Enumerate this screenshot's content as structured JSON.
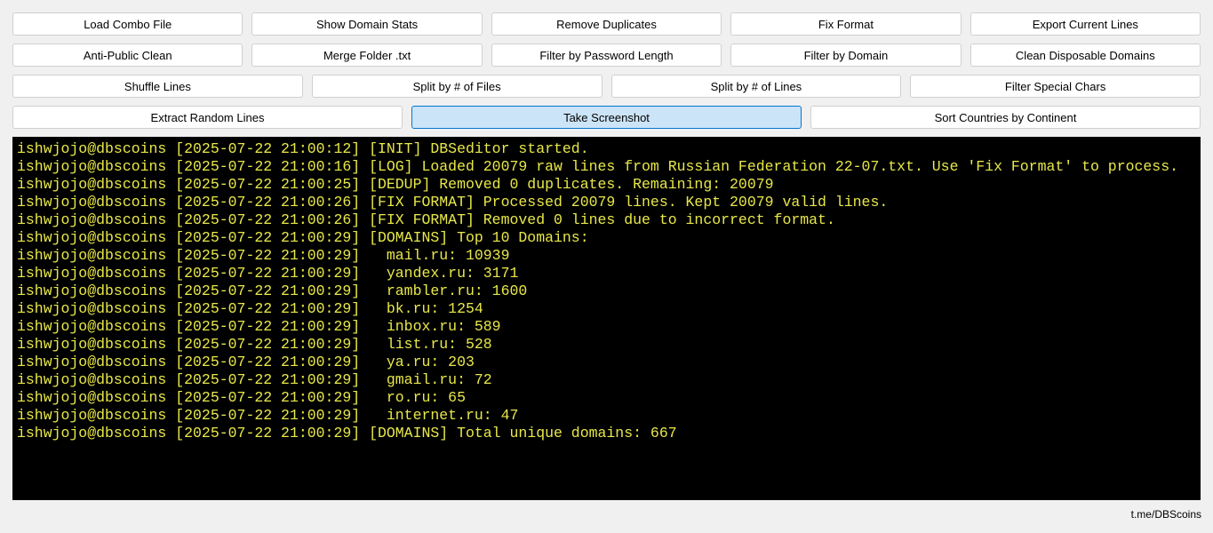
{
  "toolbar": {
    "rows": [
      [
        "Load Combo File",
        "Show Domain Stats",
        "Remove Duplicates",
        "Fix Format",
        "Export Current Lines"
      ],
      [
        "Anti-Public Clean",
        "Merge Folder .txt",
        "Filter by Password Length",
        "Filter by Domain",
        "Clean Disposable Domains"
      ],
      [
        "Shuffle Lines",
        "Split by # of Files",
        "Split by # of Lines",
        "Filter Special Chars"
      ],
      [
        "Extract Random Lines",
        "Take Screenshot",
        "Sort Countries by Continent"
      ]
    ],
    "active_button": "Take Screenshot"
  },
  "console": {
    "text_color": "#e8e84a",
    "background": "#000000",
    "lines": [
      "ishwjojo@dbscoins [2025-07-22 21:00:12] [INIT] DBSeditor started.",
      "ishwjojo@dbscoins [2025-07-22 21:00:16] [LOG] Loaded 20079 raw lines from Russian Federation 22-07.txt. Use 'Fix Format' to process.",
      "ishwjojo@dbscoins [2025-07-22 21:00:25] [DEDUP] Removed 0 duplicates. Remaining: 20079",
      "ishwjojo@dbscoins [2025-07-22 21:00:26] [FIX FORMAT] Processed 20079 lines. Kept 20079 valid lines.",
      "ishwjojo@dbscoins [2025-07-22 21:00:26] [FIX FORMAT] Removed 0 lines due to incorrect format.",
      "ishwjojo@dbscoins [2025-07-22 21:00:29] [DOMAINS] Top 10 Domains:",
      "ishwjojo@dbscoins [2025-07-22 21:00:29]   mail.ru: 10939",
      "ishwjojo@dbscoins [2025-07-22 21:00:29]   yandex.ru: 3171",
      "ishwjojo@dbscoins [2025-07-22 21:00:29]   rambler.ru: 1600",
      "ishwjojo@dbscoins [2025-07-22 21:00:29]   bk.ru: 1254",
      "ishwjojo@dbscoins [2025-07-22 21:00:29]   inbox.ru: 589",
      "ishwjojo@dbscoins [2025-07-22 21:00:29]   list.ru: 528",
      "ishwjojo@dbscoins [2025-07-22 21:00:29]   ya.ru: 203",
      "ishwjojo@dbscoins [2025-07-22 21:00:29]   gmail.ru: 72",
      "ishwjojo@dbscoins [2025-07-22 21:00:29]   ro.ru: 65",
      "ishwjojo@dbscoins [2025-07-22 21:00:29]   internet.ru: 47",
      "ishwjojo@dbscoins [2025-07-22 21:00:29] [DOMAINS] Total unique domains: 667"
    ]
  },
  "footer": {
    "link_text": "t.me/DBScoins"
  }
}
